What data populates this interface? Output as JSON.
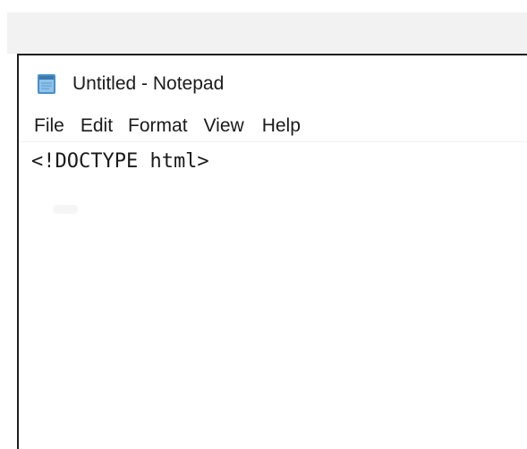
{
  "window": {
    "title": "Untitled - Notepad",
    "app_icon": "notepad-icon"
  },
  "menu": {
    "items": [
      {
        "label": "File"
      },
      {
        "label": "Edit"
      },
      {
        "label": "Format"
      },
      {
        "label": "View"
      },
      {
        "label": "Help"
      }
    ]
  },
  "editor": {
    "content": "<!DOCTYPE html>"
  },
  "colors": {
    "desktop_strip": "#f2f2f2",
    "window_border": "#1e1e1e",
    "text": "#1a1a1a",
    "icon_blue": "#4a8fc9"
  }
}
